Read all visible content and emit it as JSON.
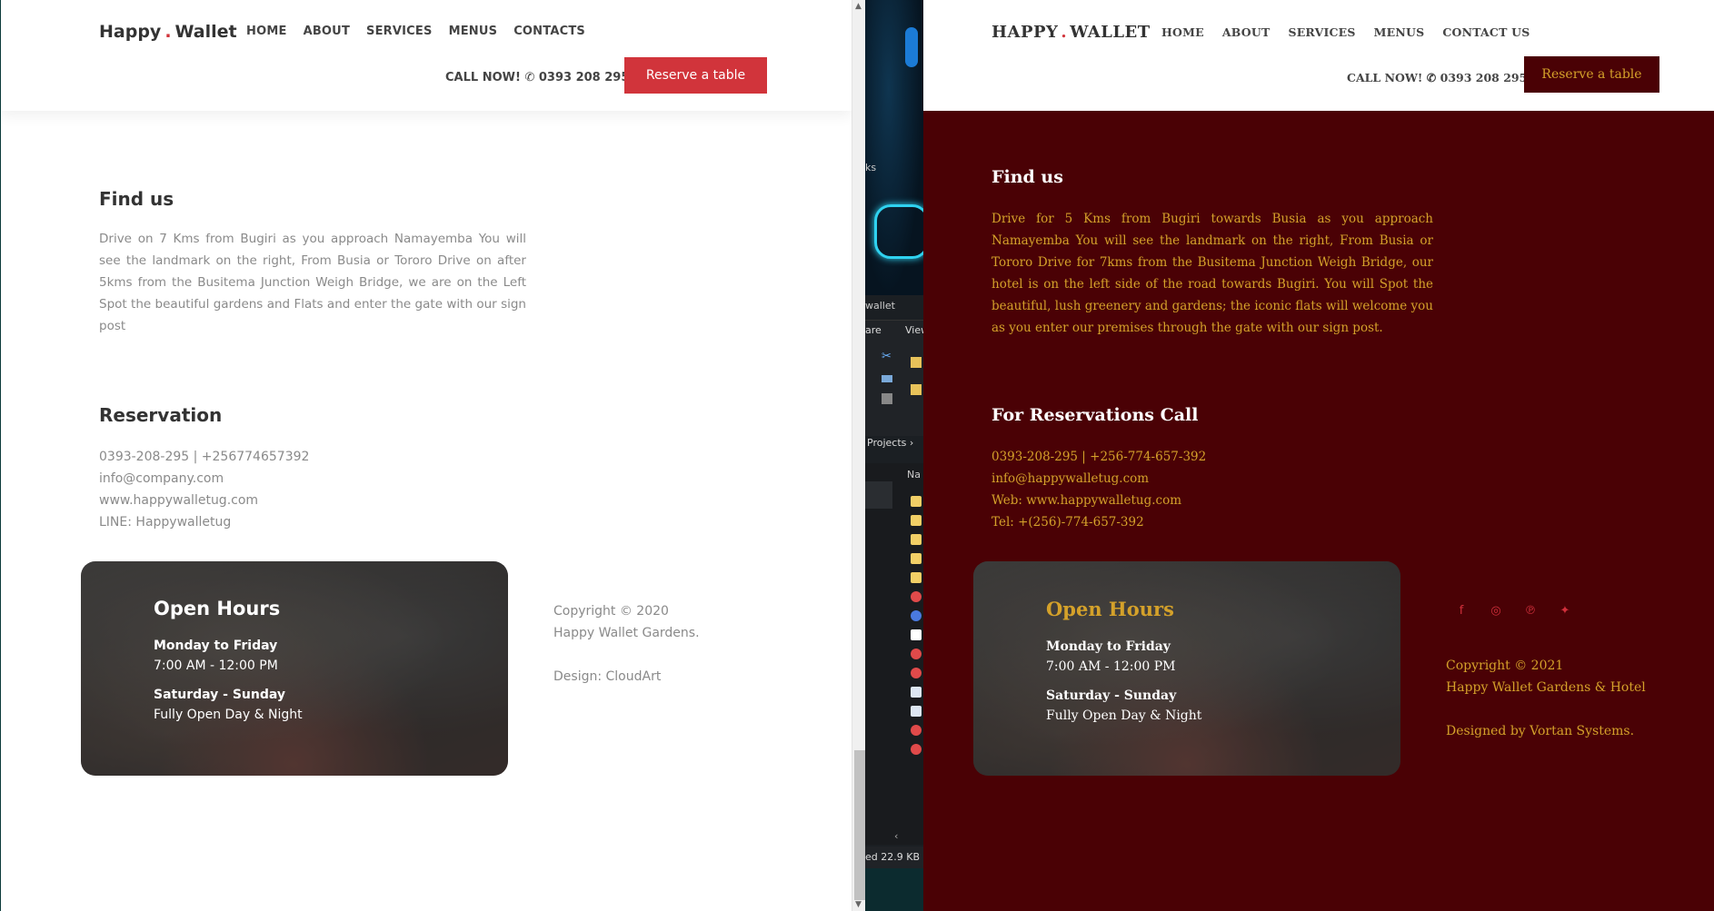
{
  "left": {
    "header": {
      "logo_a": "Happy",
      "logo_dot": ".",
      "logo_b": "Wallet",
      "nav": [
        "HOME",
        "ABOUT",
        "SERVICES",
        "MENUS",
        "CONTACTS"
      ],
      "call_label": "CALL NOW!",
      "phone": "0393 208 295",
      "reserve_label": "Reserve a table"
    },
    "find_us": {
      "title": "Find us",
      "text": "Drive on 7 Kms from Bugiri as you approach Namayemba You will see the landmark on the right, From Busia or Tororo Drive on after 5kms from the Busitema Junction Weigh Bridge, we are on the Left Spot the beautiful gardens and Flats and enter the gate with our sign post"
    },
    "reservation": {
      "title": "Reservation",
      "lines": [
        "0393-208-295 | +256774657392",
        "info@company.com",
        "www.happywalletug.com",
        "LINE: Happywalletug"
      ]
    },
    "hours": {
      "title": "Open Hours",
      "weekday_label": "Monday to Friday",
      "weekday_time": "7:00 AM - 12:00 PM",
      "weekend_label": "Saturday - Sunday",
      "weekend_time": "Fully Open Day & Night"
    },
    "copyright": {
      "line1": "Copyright © 2020",
      "line2": "Happy Wallet Gardens.",
      "design": "Design: CloudArt"
    }
  },
  "explorer": {
    "text_ks": "ks",
    "text_wallet": "wallet",
    "tab_share": "are",
    "tab_view": "View",
    "breadcrumb": "Projects",
    "column_name": "Na",
    "status_text": "ed  22.9 KB"
  },
  "right": {
    "header": {
      "logo_a": "HAPPY",
      "logo_dot": ".",
      "logo_b": "WALLET",
      "nav": [
        "HOME",
        "ABOUT",
        "SERVICES",
        "MENUS",
        "CONTACT US"
      ],
      "call_label": "CALL NOW!",
      "phone": "0393 208 295",
      "reserve_label": "Reserve a table"
    },
    "find_us": {
      "title": "Find us",
      "text": "Drive for 5 Kms from Bugiri towards Busia as you approach Namayemba You will see the landmark on the right, From Busia or Tororo Drive for 7kms from the Busitema Junction Weigh Bridge, our hotel is on the left side of the road towards Bugiri. You will Spot the beautiful, lush greenery and gardens; the iconic flats will welcome you as you enter our premises through the gate with our sign post."
    },
    "reservation": {
      "title": "For Reservations Call",
      "lines": [
        "0393-208-295 | +256-774-657-392",
        "info@happywalletug.com",
        "Web: www.happywalletug.com",
        "Tel: +(256)-774-657-392"
      ]
    },
    "hours": {
      "title": "Open Hours",
      "weekday_label": "Monday to Friday",
      "weekday_time": "7:00 AM - 12:00 PM",
      "weekend_label": "Saturday - Sunday",
      "weekend_time": "Fully Open Day & Night"
    },
    "social": [
      "facebook-icon",
      "instagram-icon",
      "pinterest-icon",
      "twitter-icon"
    ],
    "copyright": {
      "line1": "Copyright © 2021",
      "line2": "Happy Wallet Gardens & Hotel",
      "design": "Designed by Vortan Systems."
    }
  },
  "colors": {
    "accent_red": "#d1343b",
    "maroon_bg": "#4a0105",
    "gold_text": "#d4a12a",
    "gray_text": "#8a8a8a"
  }
}
